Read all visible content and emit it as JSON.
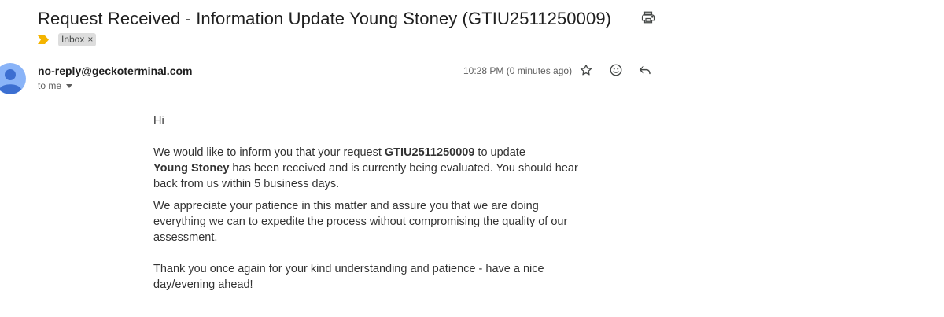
{
  "email": {
    "subject": "Request Received - Information Update Young Stoney (GTIU2511250009)",
    "labels": [
      {
        "name": "Inbox",
        "close": "×"
      }
    ],
    "sender": "no-reply@geckoterminal.com",
    "recipient": "to me",
    "timestamp": "10:28 PM (0 minutes ago)",
    "body": {
      "greeting": "Hi",
      "p1_a": "We would like to inform you that your request ",
      "p1_request_id": "GTIU2511250009",
      "p1_b": " to update ",
      "p1_token": "Young Stoney",
      "p1_c": " has been received and is currently being evaluated. You should hear back from us within 5 business days.",
      "p2": "We appreciate your patience in this matter and assure you that we are doing everything we can to expedite the process without compromising the quality of our assessment.",
      "p3": "Thank you once again for your kind understanding and patience - have a nice day/evening ahead!"
    }
  },
  "icons": {
    "print": "print-icon",
    "importance": "importance-marker-icon",
    "avatar": "default-avatar-icon",
    "star": "star-icon",
    "emoji": "emoji-reaction-icon",
    "reply": "reply-icon",
    "chevron": "chevron-down-icon"
  },
  "colors": {
    "importance": "#f4b400",
    "avatar": "#8ab4f8",
    "chip_bg": "#dddddd",
    "text": "#1f1f1f",
    "muted": "#5e5e5e"
  }
}
